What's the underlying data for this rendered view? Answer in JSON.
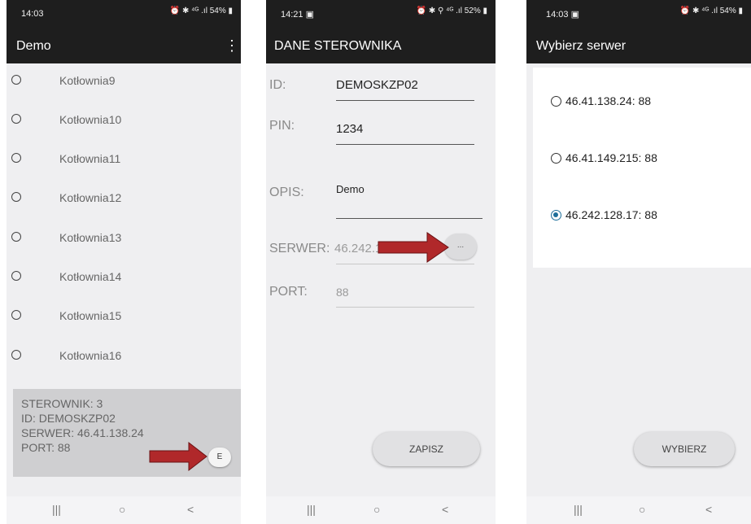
{
  "screen1": {
    "status_time": "14:03",
    "status_icons": "⏰ ✱ ⁴ᴳ .ıl 54% ▮",
    "title": "Demo",
    "menu_icon": "more-vertical-icon",
    "items": [
      {
        "label": "Kotłownia9"
      },
      {
        "label": "Kotłownia10"
      },
      {
        "label": "Kotłownia11"
      },
      {
        "label": "Kotłownia12"
      },
      {
        "label": "Kotłownia13"
      },
      {
        "label": "Kotłownia14"
      },
      {
        "label": "Kotłownia15"
      },
      {
        "label": "Kotłownia16"
      }
    ],
    "info": {
      "sterownik": "STEROWNIK: 3",
      "id": "ID: DEMOSKZP02",
      "serwer": "SERWER: 46.41.138.24",
      "port": "PORT: 88"
    },
    "edit_button": "E",
    "nav": {
      "recents": "|||",
      "home": "○",
      "back": "<"
    }
  },
  "screen2": {
    "status_time": "14:21 ▣",
    "status_icons": "⏰ ✱ ⚲ ⁴ᴳ .ıl 52% ▮",
    "title": "DANE STEROWNIKA",
    "fields": {
      "id_label": "ID:",
      "id_value": "DEMOSKZP02",
      "pin_label": "PIN:",
      "pin_value": "1234",
      "opis_label": "OPIS:",
      "opis_value": "Demo",
      "serwer_label": "SERWER:",
      "serwer_value": "46.242.128",
      "port_label": "PORT:",
      "port_value": "88"
    },
    "browse_button": "...",
    "save_button": "ZAPISZ",
    "nav": {
      "recents": "|||",
      "home": "○",
      "back": "<"
    }
  },
  "screen3": {
    "status_time": "14:03 ▣",
    "status_icons": "⏰ ✱ ⁴ᴳ .ıl 54% ▮",
    "title": "Wybierz serwer",
    "servers": [
      {
        "label": "46.41.138.24: 88",
        "selected": false
      },
      {
        "label": "46.41.149.215: 88",
        "selected": false
      },
      {
        "label": "46.242.128.17: 88",
        "selected": true
      }
    ],
    "choose_button": "WYBIERZ",
    "nav": {
      "recents": "|||",
      "home": "○",
      "back": "<"
    }
  },
  "colors": {
    "app_bar": "#1e1e1e",
    "background": "#efeff1",
    "radio_selected": "#1c6e9a",
    "arrow": "#b0282a"
  }
}
